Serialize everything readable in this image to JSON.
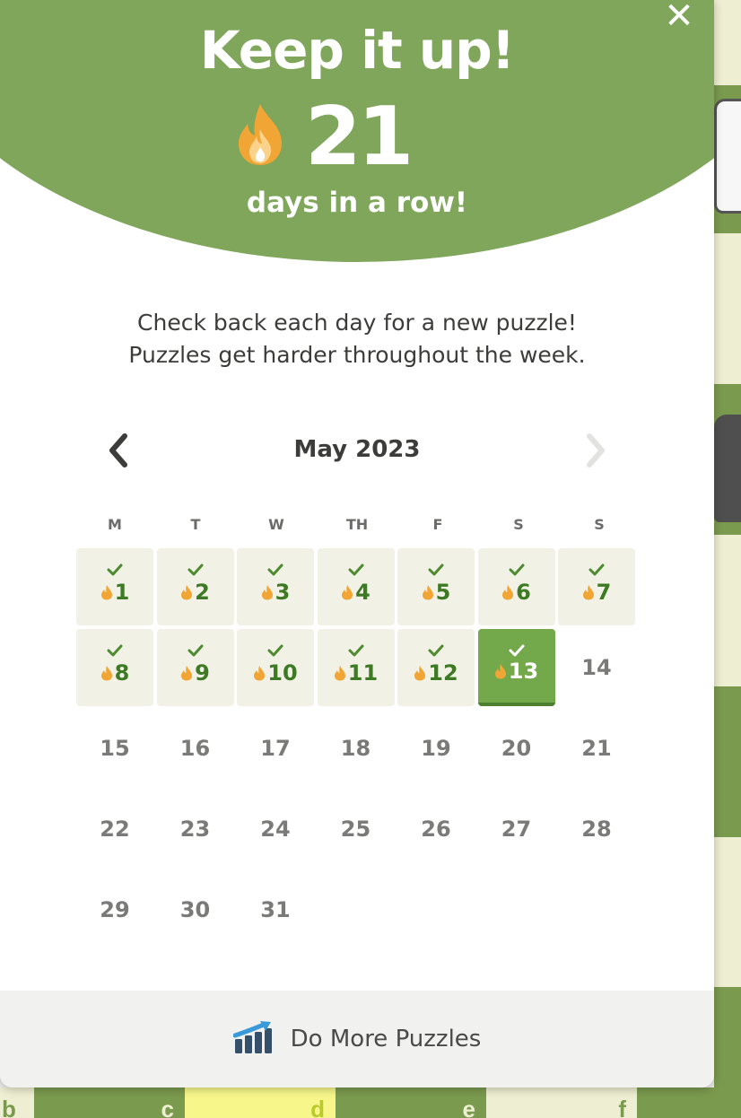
{
  "header": {
    "title": "Keep it up!",
    "streak_count": "21",
    "streak_caption": "days in a row!",
    "close_glyph": "✕"
  },
  "message": {
    "line1": "Check back each day for a new puzzle!",
    "line2": "Puzzles get harder throughout the week."
  },
  "calendar": {
    "month_label": "May 2023",
    "weekdays": [
      "M",
      "T",
      "W",
      "TH",
      "F",
      "S",
      "S"
    ],
    "days": [
      {
        "n": "1",
        "state": "done"
      },
      {
        "n": "2",
        "state": "done"
      },
      {
        "n": "3",
        "state": "done"
      },
      {
        "n": "4",
        "state": "done"
      },
      {
        "n": "5",
        "state": "done"
      },
      {
        "n": "6",
        "state": "done"
      },
      {
        "n": "7",
        "state": "done"
      },
      {
        "n": "8",
        "state": "done"
      },
      {
        "n": "9",
        "state": "done"
      },
      {
        "n": "10",
        "state": "done"
      },
      {
        "n": "11",
        "state": "done"
      },
      {
        "n": "12",
        "state": "done"
      },
      {
        "n": "13",
        "state": "today"
      },
      {
        "n": "14",
        "state": "future"
      },
      {
        "n": "15",
        "state": "future"
      },
      {
        "n": "16",
        "state": "future"
      },
      {
        "n": "17",
        "state": "future"
      },
      {
        "n": "18",
        "state": "future"
      },
      {
        "n": "19",
        "state": "future"
      },
      {
        "n": "20",
        "state": "future"
      },
      {
        "n": "21",
        "state": "future"
      },
      {
        "n": "22",
        "state": "future"
      },
      {
        "n": "23",
        "state": "future"
      },
      {
        "n": "24",
        "state": "future"
      },
      {
        "n": "25",
        "state": "future"
      },
      {
        "n": "26",
        "state": "future"
      },
      {
        "n": "27",
        "state": "future"
      },
      {
        "n": "28",
        "state": "future"
      },
      {
        "n": "29",
        "state": "future"
      },
      {
        "n": "30",
        "state": "future"
      },
      {
        "n": "31",
        "state": "future"
      }
    ]
  },
  "footer": {
    "label": "Do More Puzzles",
    "icon": "bar-chart-up-icon"
  },
  "board": {
    "files": [
      "b",
      "c",
      "d",
      "e",
      "f"
    ]
  },
  "colors": {
    "header_green": "#7fa65a",
    "completed_day_bg": "#f1f1e6",
    "completed_day_text": "#3e7a24",
    "today_bg": "#74a94b",
    "flame": "#f0a535"
  }
}
